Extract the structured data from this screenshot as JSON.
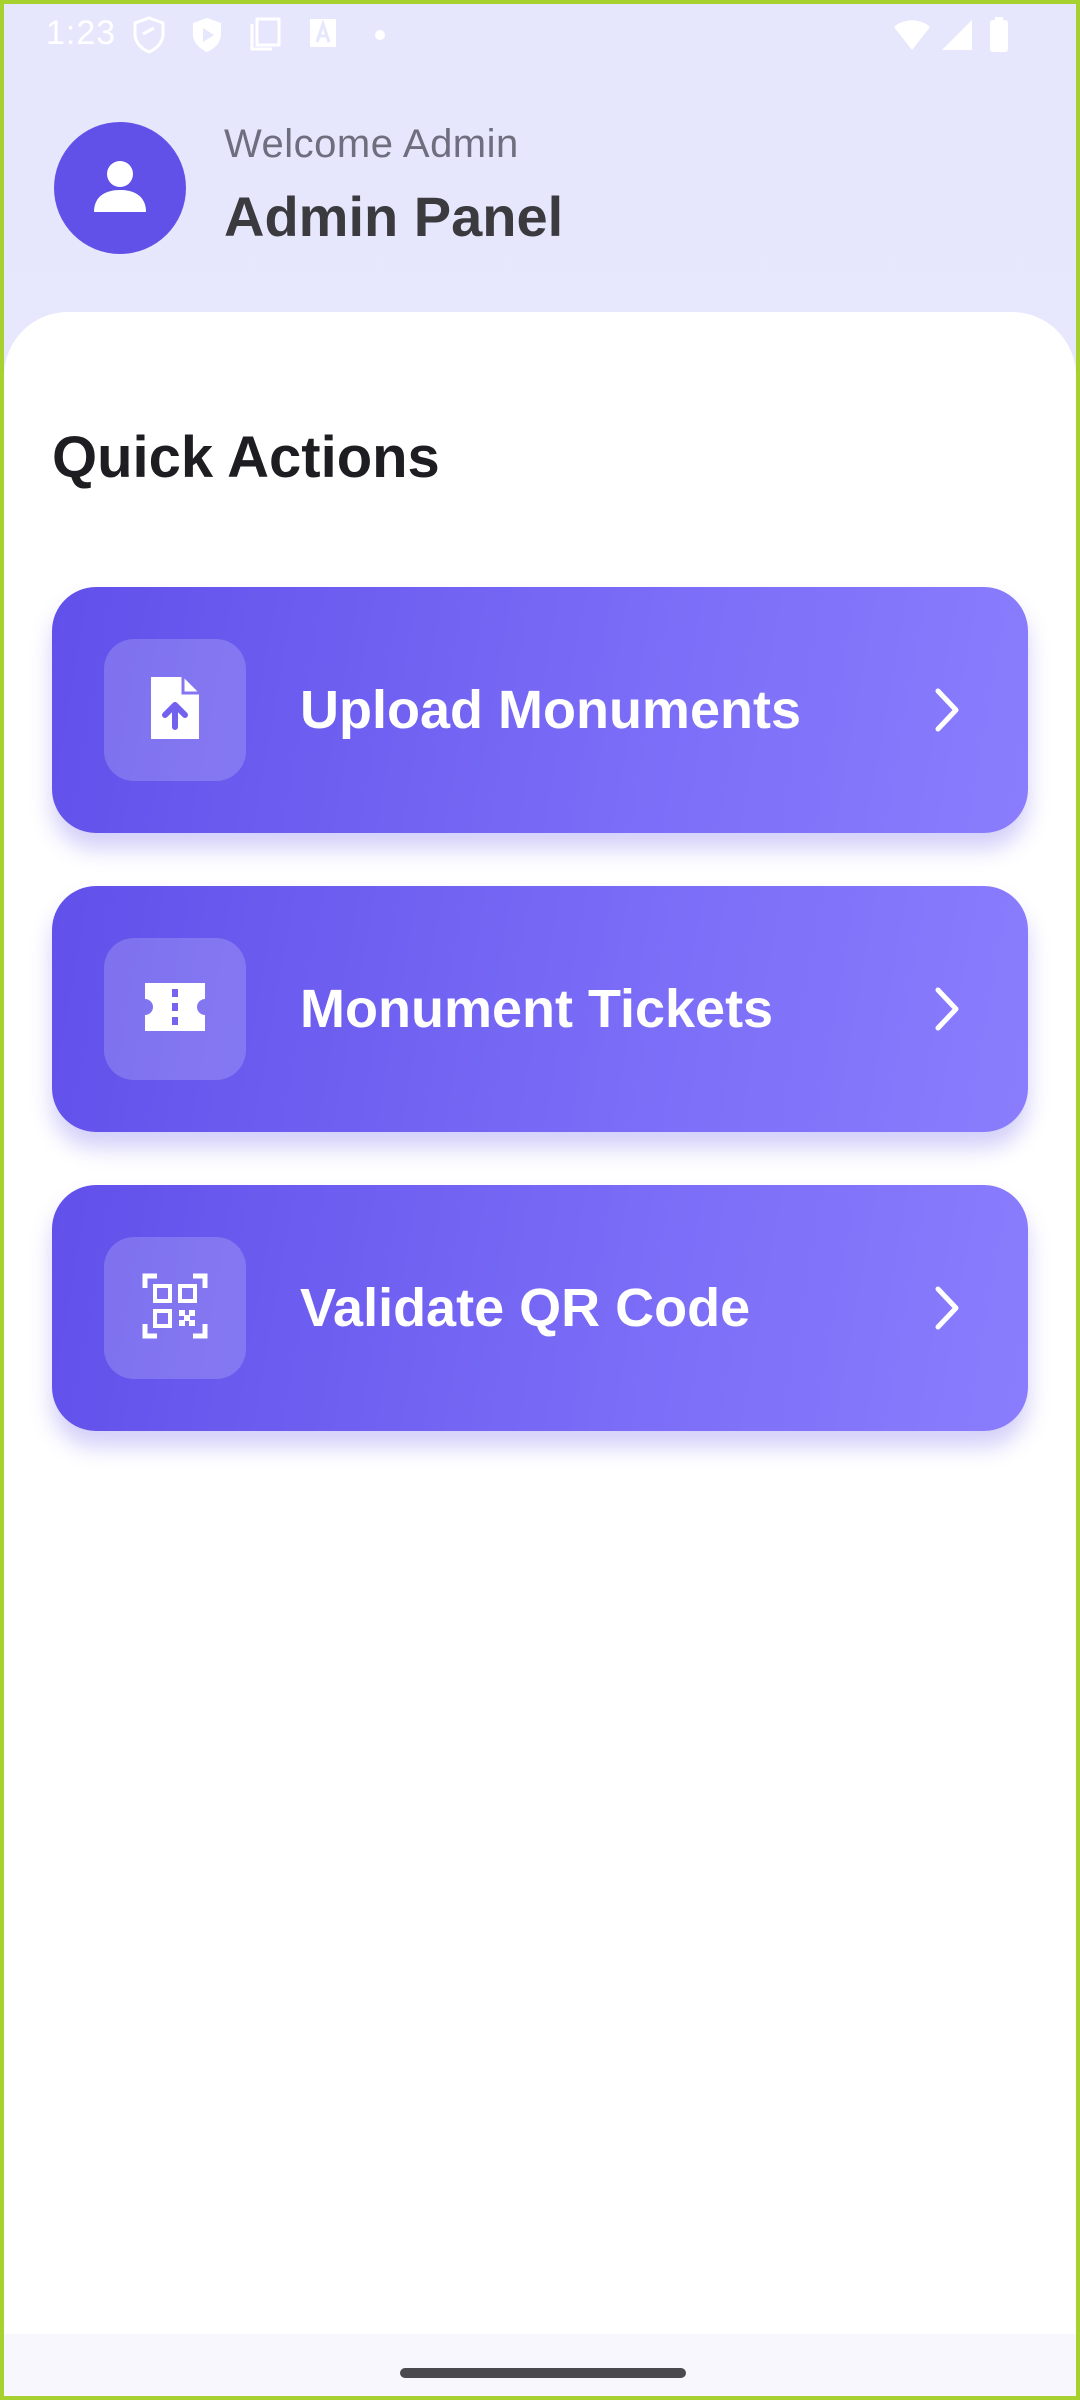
{
  "status_bar": {
    "time": "1:23",
    "icons": [
      "shield-outline-icon",
      "play-shield-icon",
      "copy-icon",
      "font-a-icon",
      "dot-icon",
      "wifi-icon",
      "cell-signal-icon",
      "battery-icon"
    ]
  },
  "header": {
    "welcome": "Welcome Admin",
    "title": "Admin Panel",
    "avatar_icon": "person-icon"
  },
  "main": {
    "section_title": "Quick Actions",
    "actions": [
      {
        "label": "Upload Monuments",
        "icon": "file-upload-icon"
      },
      {
        "label": "Monument Tickets",
        "icon": "ticket-icon"
      },
      {
        "label": "Validate QR Code",
        "icon": "qr-code-scan-icon"
      }
    ]
  },
  "colors": {
    "accent": "#6251e8",
    "card_gradient_start": "#6150ea",
    "card_gradient_end": "#8a7dfd",
    "header_bg": "#e6e7fd",
    "frame_border": "#a6d12e"
  }
}
